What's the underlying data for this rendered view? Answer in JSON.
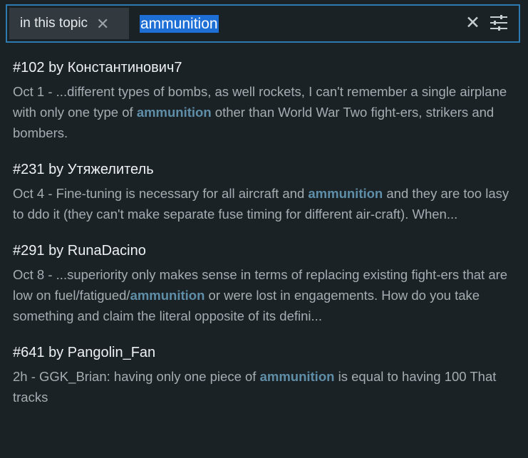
{
  "search": {
    "context_label": "in this topic",
    "query": "ammunition"
  },
  "results": [
    {
      "post_number": "#102",
      "by": "by",
      "author": "Константинович7",
      "date": "Oct 1",
      "sep": " - ",
      "before": "...different types of bombs, as well rockets, I can't remember a single airplane with only one type of ",
      "highlight": "ammunition",
      "after": " other than World War Two fight-ers, strikers and bombers."
    },
    {
      "post_number": "#231",
      "by": "by",
      "author": "Утяжелитель",
      "date": "Oct 4",
      "sep": " - ",
      "before": "Fine-tuning is necessary for all aircraft and ",
      "highlight": "ammunition",
      "after": " and they are too lasy to ddo it (they can't make separate fuse timing for different air-craft). When..."
    },
    {
      "post_number": "#291",
      "by": "by",
      "author": "RunaDacino",
      "date": "Oct 8",
      "sep": " - ",
      "before": "...superiority only makes sense in terms of replacing existing fight-ers that are low on fuel/fatigued/",
      "highlight": "ammunition",
      "after": " or were lost in engagements. How do you take something and claim the literal opposite of its defini..."
    },
    {
      "post_number": "#641",
      "by": "by",
      "author": "Pangolin_Fan",
      "date": "2h",
      "sep": " - ",
      "before": "GGK_Brian: having only one piece of ",
      "highlight": "ammunition",
      "after": " is equal to having 100 That tracks"
    }
  ]
}
